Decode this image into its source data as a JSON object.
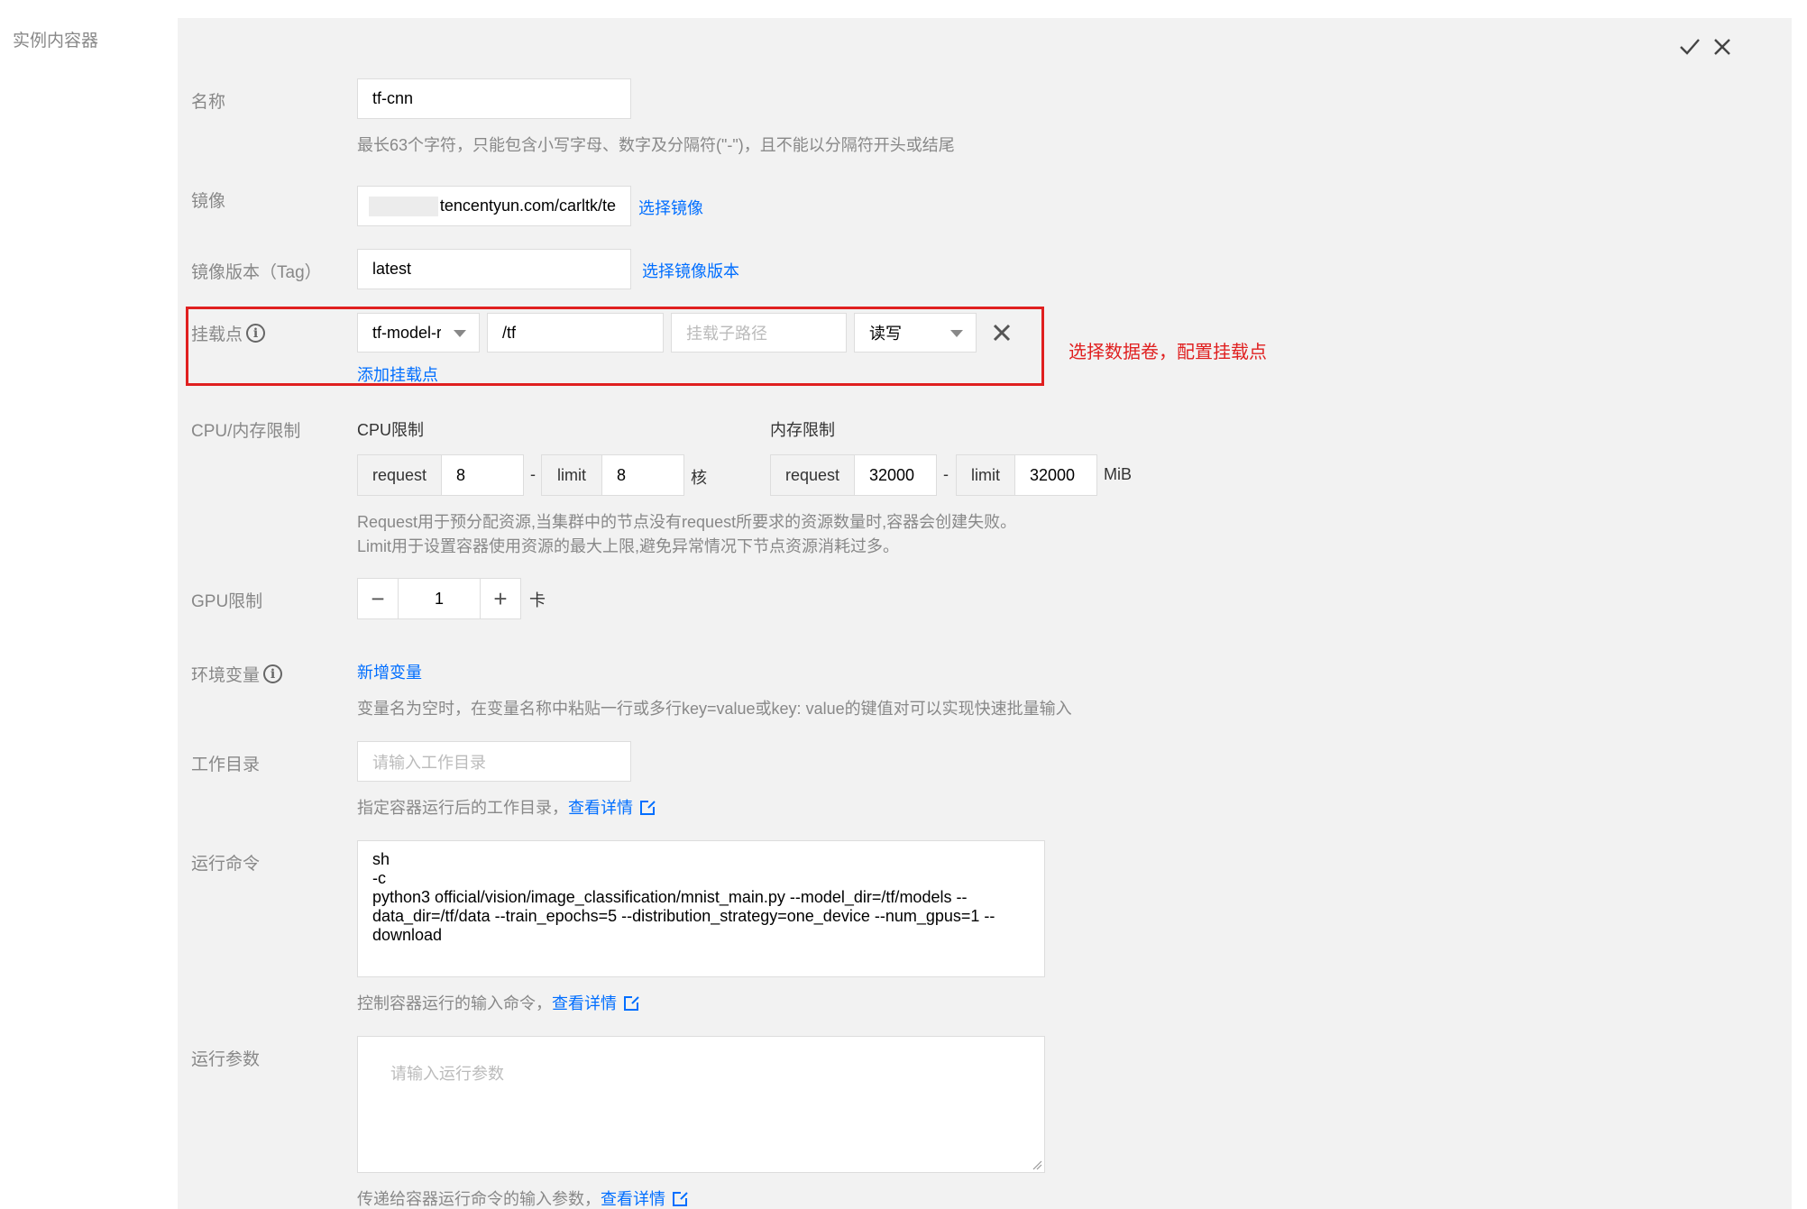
{
  "section_label": "实例内容器",
  "panel_actions": {
    "confirm_icon": "check-icon",
    "close_icon": "close-icon"
  },
  "name": {
    "label": "名称",
    "value": "tf-cnn",
    "hint": "最长63个字符，只能包含小写字母、数字及分隔符(\"-\")，且不能以分隔符开头或结尾"
  },
  "image": {
    "label": "镜像",
    "value": "tencentyun.com/carltk/te",
    "select_link": "选择镜像"
  },
  "image_tag": {
    "label": "镜像版本（Tag）",
    "value": "latest",
    "select_link": "选择镜像版本"
  },
  "mount": {
    "label": "挂载点",
    "volume": "tf-model-r",
    "path": "/tf",
    "subpath_placeholder": "挂载子路径",
    "mode": "读写",
    "add_link": "添加挂载点",
    "annotation": "选择数据卷，配置挂载点"
  },
  "resources": {
    "label": "CPU/内存限制",
    "cpu_title": "CPU限制",
    "mem_title": "内存限制",
    "request_label": "request",
    "limit_label": "limit",
    "cpu_request": "8",
    "cpu_limit": "8",
    "cpu_unit": "核",
    "mem_request": "32000",
    "mem_limit": "32000",
    "mem_unit": "MiB",
    "dash": "-",
    "hint_line1": "Request用于预分配资源,当集群中的节点没有request所要求的资源数量时,容器会创建失败。",
    "hint_line2": "Limit用于设置容器使用资源的最大上限,避免异常情况下节点资源消耗过多。"
  },
  "gpu": {
    "label": "GPU限制",
    "value": "1",
    "unit": "卡",
    "minus": "−",
    "plus": "+"
  },
  "env": {
    "label": "环境变量",
    "add_link": "新增变量",
    "hint": "变量名为空时，在变量名称中粘贴一行或多行key=value或key: value的键值对可以实现快速批量输入"
  },
  "workdir": {
    "label": "工作目录",
    "placeholder": "请输入工作目录",
    "hint": "指定容器运行后的工作目录，",
    "detail_link": "查看详情"
  },
  "command": {
    "label": "运行命令",
    "value": "sh\n-c\npython3 official/vision/image_classification/mnist_main.py --model_dir=/tf/models --\ndata_dir=/tf/data --train_epochs=5 --distribution_strategy=one_device --num_gpus=1 --\ndownload",
    "hint": "控制容器运行的输入命令，",
    "detail_link": "查看详情"
  },
  "args": {
    "label": "运行参数",
    "placeholder": "请输入运行参数",
    "hint": "传递给容器运行命令的输入参数，",
    "detail_link": "查看详情"
  }
}
